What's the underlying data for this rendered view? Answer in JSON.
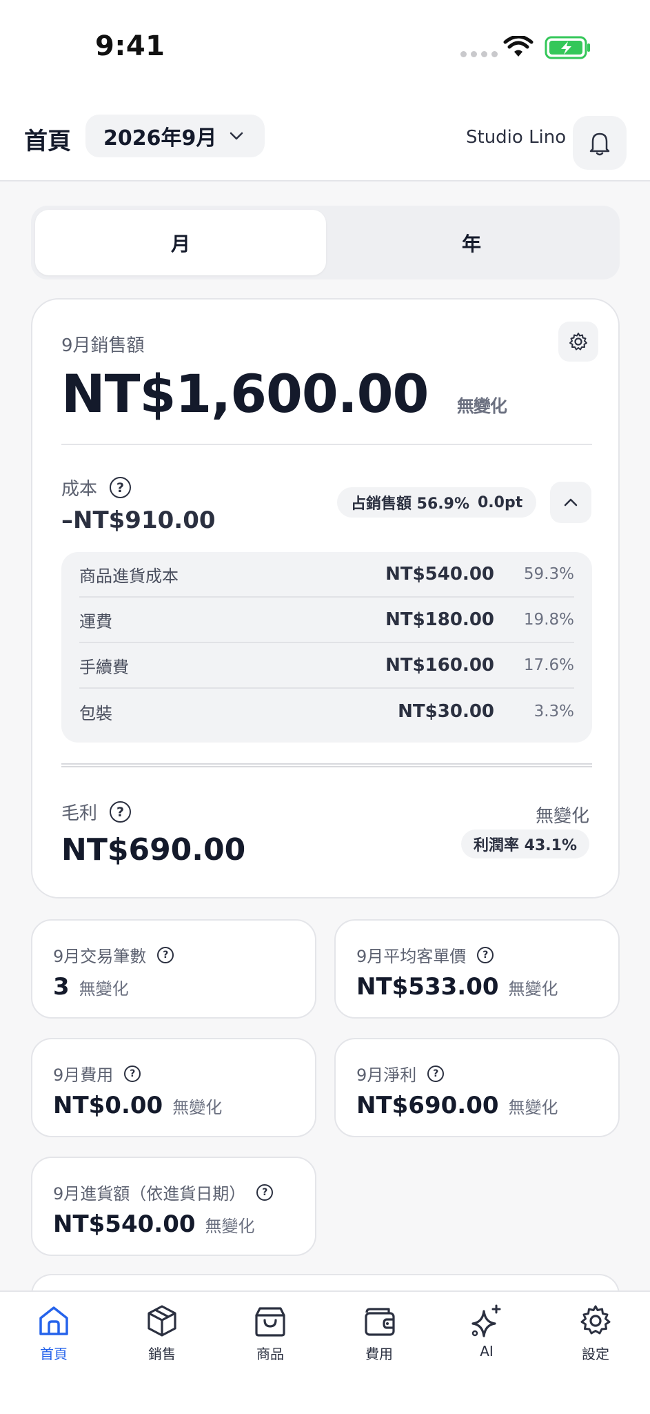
{
  "status_bar": {
    "time": "9:41"
  },
  "header": {
    "title": "首頁",
    "month_selector": "2026年9月",
    "shop_name": "Studio Lino"
  },
  "segment": {
    "month": "月",
    "year": "年"
  },
  "sales": {
    "label": "9月銷售額",
    "value": "NT$1,600.00",
    "change": "無變化"
  },
  "cost": {
    "label": "成本",
    "value": "–NT$910.00",
    "badge_label": "占銷售額 56.9%",
    "badge_delta": "0.0pt",
    "items": [
      {
        "name": "商品進貨成本",
        "amount": "NT$540.00",
        "pct": "59.3%"
      },
      {
        "name": "運費",
        "amount": "NT$180.00",
        "pct": "19.8%"
      },
      {
        "name": "手續費",
        "amount": "NT$160.00",
        "pct": "17.6%"
      },
      {
        "name": "包裝",
        "amount": "NT$30.00",
        "pct": "3.3%"
      }
    ]
  },
  "gross_profit": {
    "label": "毛利",
    "value": "NT$690.00",
    "change": "無變化",
    "margin": "利潤率 43.1%"
  },
  "stats": [
    {
      "label": "9月交易筆數",
      "value": "3",
      "change": "無變化"
    },
    {
      "label": "9月平均客單價",
      "value": "NT$533.00",
      "change": "無變化"
    },
    {
      "label": "9月費用",
      "value": "NT$0.00",
      "change": "無變化"
    },
    {
      "label": "9月淨利",
      "value": "NT$690.00",
      "change": "無變化"
    },
    {
      "label": "9月進貨額（依進貨日期）",
      "value": "NT$540.00",
      "change": "無變化"
    }
  ],
  "tabs": [
    {
      "label": "首頁",
      "icon": "home-icon",
      "active": true
    },
    {
      "label": "銷售",
      "icon": "box-icon"
    },
    {
      "label": "商品",
      "icon": "bag-icon"
    },
    {
      "label": "費用",
      "icon": "wallet-icon"
    },
    {
      "label": "AI",
      "icon": "sparkle-icon"
    },
    {
      "label": "設定",
      "icon": "gear-icon"
    }
  ],
  "colors": {
    "accent": "#2563eb",
    "text": "#141a2b",
    "muted": "#6b7080",
    "battery": "#34c759"
  }
}
